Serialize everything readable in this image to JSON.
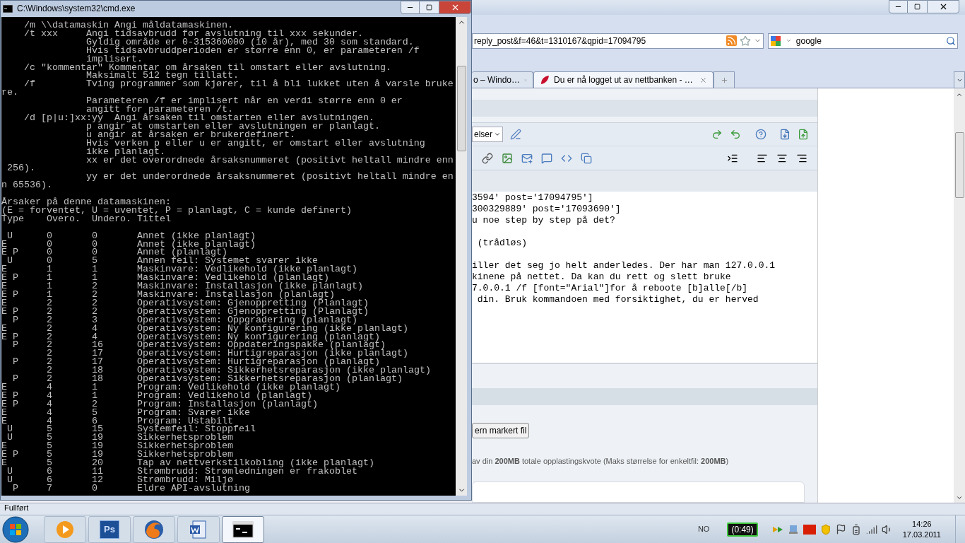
{
  "cmd_window": {
    "title": "C:\\Windows\\system32\\cmd.exe",
    "help_lines": [
      "    /m \\\\datamaskin Angi måldatamaskinen.",
      "    /t xxx     Angi tidsavbrudd før avslutning til xxx sekunder.",
      "               Gyldig område er 0-315360000 (10 år), med 30 som standard.",
      "               Hvis tidsavbruddperioden er større enn 0, er parameteren /f",
      "               implisert.",
      "    /c \"kommentar\" Kommentar om årsaken til omstart eller avslutning.",
      "               Maksimalt 512 tegn tillatt.",
      "    /f         Tving programmer som kjører, til å bli lukket uten å varsle bruke",
      "re.",
      "               Parameteren /f er implisert når en verdi større enn 0 er",
      "               angitt for parameteren /t.",
      "    /d [p|u:]xx:yy  Angi årsaken til omstarten eller avslutningen.",
      "               p angir at omstarten eller avslutningen er planlagt.",
      "               u angir at årsaken er brukerdefinert.",
      "               Hvis verken p eller u er angitt, er omstart eller avslutning",
      "               ikke planlagt.",
      "               xx er det overordnede årsaksnummeret (positivt heltall mindre enn",
      " 256).",
      "               yy er det underordnede årsaksnummeret (positivt heltall mindre en",
      "n 65536)."
    ],
    "reasons_heading": "Årsaker på denne datamaskinen:",
    "legend": "(E = forventet, U = uventet, P = planlagt, C = kunde definert)",
    "reasons_table": {
      "columns": [
        "Type",
        "Overo.",
        "Undero.",
        "Tittel"
      ],
      "rows": [
        {
          "type": " U",
          "major": "0",
          "minor": "0",
          "title": "Annet (ikke planlagt)"
        },
        {
          "type": "E",
          "major": "0",
          "minor": "0",
          "title": "Annet (ikke planlagt)"
        },
        {
          "type": "E P",
          "major": "0",
          "minor": "0",
          "title": "Annet (planlagt)"
        },
        {
          "type": " U",
          "major": "0",
          "minor": "5",
          "title": "Annen feil: Systemet svarer ikke"
        },
        {
          "type": "E",
          "major": "1",
          "minor": "1",
          "title": "Maskinvare: Vedlikehold (ikke planlagt)"
        },
        {
          "type": "E P",
          "major": "1",
          "minor": "1",
          "title": "Maskinvare: Vedlikehold (planlagt)"
        },
        {
          "type": "E",
          "major": "1",
          "minor": "2",
          "title": "Maskinvare: Installasjon (ikke planlagt)"
        },
        {
          "type": "E P",
          "major": "1",
          "minor": "2",
          "title": "Maskinvare: Installasjon (planlagt)"
        },
        {
          "type": "E",
          "major": "2",
          "minor": "2",
          "title": "Operativsystem: Gjenoppretting (Planlagt)"
        },
        {
          "type": "E P",
          "major": "2",
          "minor": "2",
          "title": "Operativsystem: Gjenoppretting (Planlagt)"
        },
        {
          "type": "  P",
          "major": "2",
          "minor": "3",
          "title": "Operativsystem: Oppgradering (planlagt)"
        },
        {
          "type": "E",
          "major": "2",
          "minor": "4",
          "title": "Operativsystem: Ny konfigurering (ikke planlagt)"
        },
        {
          "type": "E P",
          "major": "2",
          "minor": "4",
          "title": "Operativsystem: Ny konfigurering (planlagt)"
        },
        {
          "type": "  P",
          "major": "2",
          "minor": "16",
          "title": "Operativsystem: Oppdateringspakke (planlagt)"
        },
        {
          "major": "2",
          "minor": "17",
          "title": "Operativsystem: Hurtigreparasjon (ikke planlagt)"
        },
        {
          "type": "  P",
          "major": "2",
          "minor": "17",
          "title": "Operativsystem: Hurtigreparasjon (planlagt)"
        },
        {
          "major": "2",
          "minor": "18",
          "title": "Operativsystem: Sikkerhetsreparasjon (ikke planlagt)"
        },
        {
          "type": "  P",
          "major": "2",
          "minor": "18",
          "title": "Operativsystem: Sikkerhetsreparasjon (planlagt)"
        },
        {
          "type": "E",
          "major": "4",
          "minor": "1",
          "title": "Program: Vedlikehold (ikke planlagt)"
        },
        {
          "type": "E P",
          "major": "4",
          "minor": "1",
          "title": "Program: Vedlikehold (planlagt)"
        },
        {
          "type": "E P",
          "major": "4",
          "minor": "2",
          "title": "Program: Installasjon (planlagt)"
        },
        {
          "type": "E",
          "major": "4",
          "minor": "5",
          "title": "Program: Svarer ikke"
        },
        {
          "type": "E",
          "major": "4",
          "minor": "6",
          "title": "Program: Ustabilt"
        },
        {
          "type": " U",
          "major": "5",
          "minor": "15",
          "title": "Systemfeil: Stoppfeil"
        },
        {
          "type": " U",
          "major": "5",
          "minor": "19",
          "title": "Sikkerhetsproblem"
        },
        {
          "type": "E",
          "major": "5",
          "minor": "19",
          "title": "Sikkerhetsproblem"
        },
        {
          "type": "E P",
          "major": "5",
          "minor": "19",
          "title": "Sikkerhetsproblem"
        },
        {
          "type": "E",
          "major": "5",
          "minor": "20",
          "title": "Tap av nettverkstilkobling (ikke planlagt)"
        },
        {
          "type": " U",
          "major": "6",
          "minor": "11",
          "title": "Strømbrudd: Strømledningen er frakoblet"
        },
        {
          "type": " U",
          "major": "6",
          "minor": "12",
          "title": "Strømbrudd: Miljø"
        },
        {
          "type": "  P",
          "major": "7",
          "minor": "0",
          "title": "Eldre API-avslutning"
        }
      ]
    }
  },
  "browser": {
    "url": "reply_post&f=46&t=1310167&qpid=17094795",
    "search": {
      "value": "google"
    },
    "tabs": [
      {
        "label": "o – Windo…",
        "selected": false
      },
      {
        "label": "Du er nå logget ut av nettbanken - …",
        "selected": true
      }
    ],
    "editor": {
      "format_select": "elser",
      "text_blocks": [
        [
          "3594' post='17094795']",
          "300329889' post='17093690']",
          "u noe step by step på det?"
        ],
        [
          " (trådløs)"
        ],
        [
          "iller det seg jo helt anderledes. Der har man 127.0.0.1",
          "kinene på nettet. Da kan du rett og slett bruke",
          "7.0.0.1 /f [font=\"Arial\"]for å reboote [b]alle[/b]",
          " din. Bruk kommandoen med forsiktighet, du er herved"
        ]
      ]
    },
    "remove_button": "ern markert fil",
    "quota_note": "av din **200MB** totale opplastingskvote (Maks størrelse for enkeltfil: **200MB**)",
    "status": "Fullført"
  },
  "taskbar": {
    "apps": [
      {
        "kind": "media",
        "active": false
      },
      {
        "kind": "photoshop",
        "label": "Ps",
        "active": false
      },
      {
        "kind": "firefox",
        "active": false
      },
      {
        "kind": "word",
        "active": false
      },
      {
        "kind": "console",
        "active": true
      }
    ],
    "language": "NO",
    "battery_label": "(0:49)",
    "time": "14:26",
    "date": "17.03.2011"
  }
}
